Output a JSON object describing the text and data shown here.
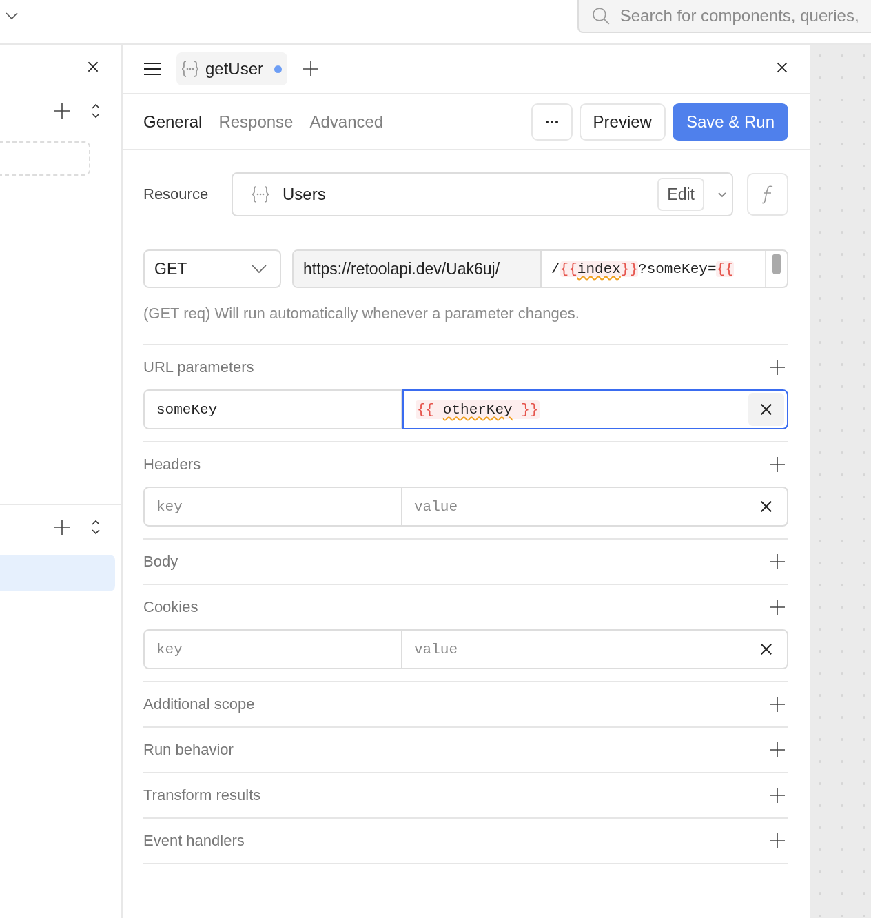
{
  "top_bar": {
    "search": {
      "placeholder": "Search for components, queries,"
    }
  },
  "query_tab": {
    "label": "getUser",
    "unsaved": true
  },
  "tabs": [
    {
      "label": "General",
      "selected": true
    },
    {
      "label": "Response",
      "selected": false
    },
    {
      "label": "Advanced",
      "selected": false
    }
  ],
  "actions": {
    "preview": "Preview",
    "save_run": "Save & Run"
  },
  "resource": {
    "label": "Resource",
    "value": "Users",
    "edit": "Edit"
  },
  "request": {
    "method": "GET",
    "base_url": "https://retoolapi.dev/Uak6uj/",
    "path": [
      {
        "kind": "text",
        "text": "/"
      },
      {
        "kind": "template",
        "open": "{{",
        "inner": "index",
        "close": "}}"
      },
      {
        "kind": "text",
        "text": "?someKey="
      },
      {
        "kind": "template",
        "open": "{{"
      }
    ]
  },
  "hint": "(GET req) Will run automatically whenever a parameter changes.",
  "sections": [
    {
      "title": "URL parameters",
      "rows": [
        {
          "key": "someKey",
          "value": {
            "open": "{{",
            "inner": "otherKey",
            "close": "}}"
          },
          "focused": true
        }
      ]
    },
    {
      "title": "Headers",
      "rows": [
        {
          "key_placeholder": "key",
          "value_placeholder": "value",
          "focused": false
        }
      ]
    },
    {
      "title": "Body"
    },
    {
      "title": "Cookies",
      "rows": [
        {
          "key_placeholder": "key",
          "value_placeholder": "value",
          "focused": false
        }
      ]
    },
    {
      "title": "Additional scope"
    },
    {
      "title": "Run behavior"
    },
    {
      "title": "Transform results"
    },
    {
      "title": "Event handlers"
    }
  ]
}
